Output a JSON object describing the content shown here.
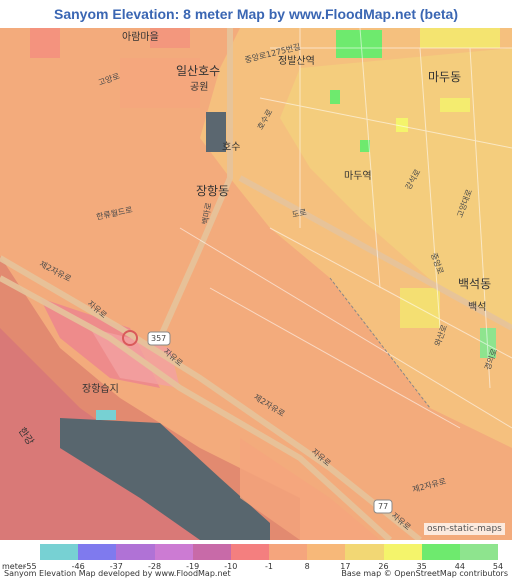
{
  "title": "Sanyom Elevation: 8 meter Map by www.FloodMap.net (beta)",
  "map": {
    "place_labels": [
      {
        "key": "janghang_dong",
        "text": "장항동"
      },
      {
        "key": "madu_dong",
        "text": "마두동"
      },
      {
        "key": "madu_station",
        "text": "마두역"
      },
      {
        "key": "baekseok_dong",
        "text": "백석동"
      },
      {
        "key": "baekseok",
        "text": "백석"
      },
      {
        "key": "ilsan_lake_park",
        "text": "일산호수"
      },
      {
        "key": "park",
        "text": "공원"
      },
      {
        "key": "jeongbalsan_station",
        "text": "정발산역"
      },
      {
        "key": "janghang_wetland",
        "text": "장항습지"
      },
      {
        "key": "hangang",
        "text": "한강"
      },
      {
        "key": "lake",
        "text": "호수"
      },
      {
        "key": "arambaeum",
        "text": "아람마을"
      }
    ],
    "road_labels": [
      {
        "key": "jungang_ro",
        "text": "중앙로1275번길"
      },
      {
        "key": "hosu_ro",
        "text": "호수로"
      },
      {
        "key": "baengma_ro",
        "text": "백마로"
      },
      {
        "key": "hallyu_world_ro",
        "text": "한류월드로"
      },
      {
        "key": "jayu_ro_1",
        "text": "자유로"
      },
      {
        "key": "jayu_ro_2",
        "text": "자유로"
      },
      {
        "key": "jayu_ro_3",
        "text": "자유로"
      },
      {
        "key": "jayu_ro_4",
        "text": "자유로"
      },
      {
        "key": "je2_jayu_ro_1",
        "text": "제2자유로"
      },
      {
        "key": "je2_jayu_ro_2",
        "text": "제2자유로"
      },
      {
        "key": "je2_jayu_ro_3",
        "text": "제2자유로"
      },
      {
        "key": "to_ro",
        "text": "도로"
      },
      {
        "key": "gogyang_ro",
        "text": "고양로"
      },
      {
        "key": "gangseok_ro",
        "text": "강석로"
      },
      {
        "key": "jungang_ro2",
        "text": "중앙로"
      },
      {
        "key": "wasan_ro",
        "text": "와산로"
      },
      {
        "key": "goyang_ro2",
        "text": "고양대로"
      },
      {
        "key": "gyeongui_ro",
        "text": "경의로"
      }
    ],
    "route_shields": [
      {
        "key": "route_357",
        "text": "357"
      },
      {
        "key": "route_77",
        "text": "77"
      }
    ],
    "attribution_tag": "osm-static-maps"
  },
  "legend": {
    "unit": "meter",
    "items": [
      {
        "value": "-55",
        "color": "#ffffff"
      },
      {
        "value": "-46",
        "color": "#77d1d3"
      },
      {
        "value": "-37",
        "color": "#7f7aee"
      },
      {
        "value": "-28",
        "color": "#b072d6"
      },
      {
        "value": "-19",
        "color": "#cc7bd3"
      },
      {
        "value": "-10",
        "color": "#c86aa8"
      },
      {
        "value": "-1",
        "color": "#f47f7f"
      },
      {
        "value": "8",
        "color": "#f5a57d"
      },
      {
        "value": "17",
        "color": "#f7b879"
      },
      {
        "value": "26",
        "color": "#f2d774"
      },
      {
        "value": "35",
        "color": "#f4f46b"
      },
      {
        "value": "44",
        "color": "#6eea6e"
      },
      {
        "value": "54",
        "color": "#8ee48e"
      }
    ]
  },
  "footer": {
    "left": "Sanyom Elevation Map developed by www.FloodMap.net",
    "right": "Base map © OpenStreetMap contributors"
  }
}
